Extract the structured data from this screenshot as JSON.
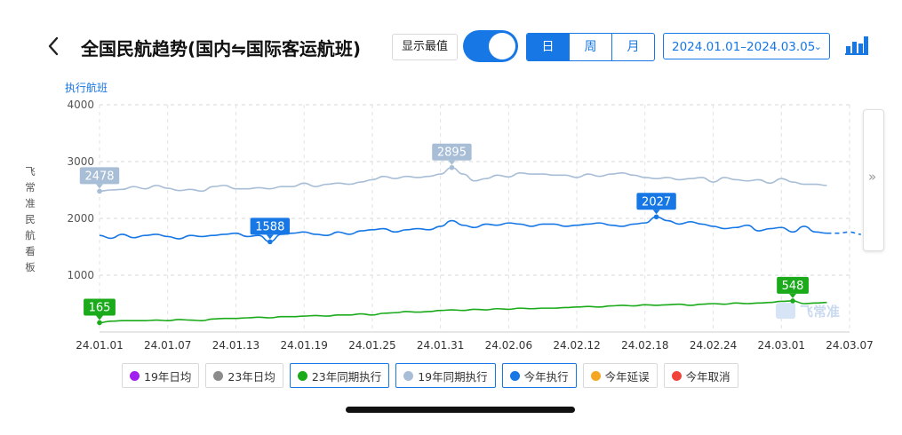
{
  "header": {
    "title": "全国民航趋势(国内⇋国际客运航班)",
    "show_best_label": "显示最值",
    "toggle_on": true,
    "periods": [
      "日",
      "周",
      "月"
    ],
    "active_period": "日",
    "date_range": "2024.01.01–2024.03.05",
    "date_chevron": "⌄"
  },
  "y_axis_name": "执行航班",
  "vertical_label": "飞常准民航看板",
  "side_arrow": "»",
  "watermark": "飞常准",
  "legend": [
    {
      "label": "19年日均",
      "color": "#a020f0",
      "on": false
    },
    {
      "label": "23年日均",
      "color": "#8c8c8c",
      "on": false
    },
    {
      "label": "23年同期执行",
      "color": "#1aaa1a",
      "on": true
    },
    {
      "label": "19年同期执行",
      "color": "#a8bed6",
      "on": true
    },
    {
      "label": "今年执行",
      "color": "#1677e5",
      "on": true
    },
    {
      "label": "今年延误",
      "color": "#f5a623",
      "on": false
    },
    {
      "label": "今年取消",
      "color": "#f0433a",
      "on": false
    }
  ],
  "chart_data": {
    "type": "line",
    "ylabel": "执行航班",
    "ylim": [
      0,
      4000
    ],
    "yticks": [
      1000,
      2000,
      3000,
      4000
    ],
    "x_ticks": [
      "24.01.01",
      "24.01.07",
      "24.01.13",
      "24.01.19",
      "24.01.25",
      "24.01.31",
      "24.02.06",
      "24.02.12",
      "24.02.18",
      "24.02.24",
      "24.03.01",
      "24.03.07"
    ],
    "grid": true,
    "series": [
      {
        "name": "19年同期执行",
        "color": "#a8bed6",
        "values": [
          2478,
          2500,
          2510,
          2560,
          2520,
          2580,
          2530,
          2490,
          2510,
          2480,
          2560,
          2580,
          2520,
          2520,
          2540,
          2520,
          2560,
          2560,
          2620,
          2560,
          2600,
          2620,
          2600,
          2640,
          2680,
          2740,
          2700,
          2740,
          2720,
          2740,
          2780,
          2895,
          2780,
          2660,
          2700,
          2760,
          2730,
          2800,
          2780,
          2780,
          2760,
          2760,
          2720,
          2780,
          2740,
          2780,
          2800,
          2760,
          2720,
          2700,
          2720,
          2680,
          2700,
          2720,
          2640,
          2720,
          2680,
          2660,
          2680,
          2620,
          2700,
          2640,
          2600,
          2600,
          2580
        ]
      },
      {
        "name": "今年执行",
        "color": "#1677e5",
        "values": [
          1700,
          1650,
          1720,
          1660,
          1700,
          1720,
          1680,
          1640,
          1700,
          1680,
          1700,
          1720,
          1740,
          1680,
          1700,
          1588,
          1720,
          1740,
          1760,
          1720,
          1700,
          1760,
          1720,
          1780,
          1800,
          1820,
          1760,
          1800,
          1820,
          1800,
          1860,
          1960,
          1880,
          1840,
          1900,
          1880,
          1920,
          1900,
          1860,
          1900,
          1900,
          1860,
          1880,
          1900,
          1920,
          1880,
          1860,
          1900,
          1920,
          2027,
          1960,
          1900,
          1940,
          1900,
          1860,
          1820,
          1840,
          1880,
          1780,
          1820,
          1840,
          1760,
          1860,
          1760,
          1740
        ],
        "forecast": [
          1740,
          1760,
          1720
        ]
      },
      {
        "name": "23年同期执行",
        "color": "#1aaa1a",
        "values": [
          165,
          190,
          200,
          200,
          200,
          210,
          200,
          220,
          210,
          200,
          230,
          240,
          240,
          250,
          260,
          250,
          270,
          270,
          280,
          290,
          280,
          300,
          300,
          320,
          300,
          330,
          340,
          360,
          350,
          360,
          380,
          390,
          380,
          400,
          390,
          410,
          400,
          420,
          410,
          420,
          420,
          430,
          440,
          450,
          440,
          460,
          470,
          460,
          480,
          470,
          480,
          490,
          470,
          490,
          500,
          490,
          510,
          500,
          510,
          520,
          540,
          548,
          500,
          510,
          520
        ]
      }
    ],
    "annotations": [
      {
        "series": "19年同期执行",
        "index": 0,
        "label": "2478"
      },
      {
        "series": "19年同期执行",
        "index": 31,
        "label": "2895"
      },
      {
        "series": "今年执行",
        "index": 15,
        "label": "1588"
      },
      {
        "series": "今年执行",
        "index": 49,
        "label": "2027"
      },
      {
        "series": "23年同期执行",
        "index": 0,
        "label": "165"
      },
      {
        "series": "23年同期执行",
        "index": 61,
        "label": "548"
      }
    ]
  }
}
